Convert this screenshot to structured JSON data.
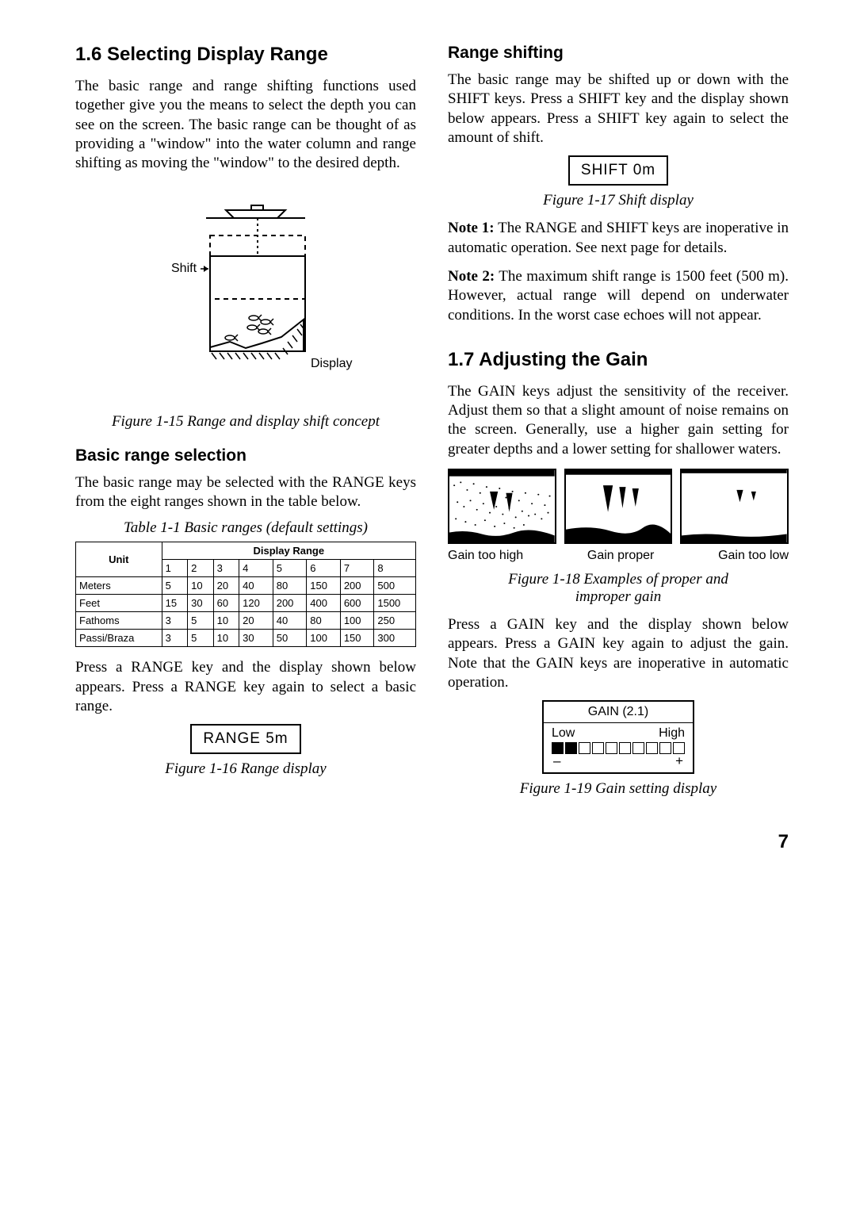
{
  "left": {
    "section_1_6_title": "1.6 Selecting Display Range",
    "para_1": "The basic range and range shifting functions used together give you the means to select the depth you can see on the screen. The basic range can be thought of as providing a \"window\" into the water column and range shifting as moving the \"window\" to the desired depth.",
    "shift_label": "Shift",
    "display_label": "Display",
    "fig15_caption": "Figure 1-15 Range and display shift concept",
    "basic_range_heading": "Basic range selection",
    "para_2": "The basic range may be selected with the RANGE keys from the eight ranges shown in the table below.",
    "table_caption": "Table 1-1 Basic ranges (default settings)",
    "table": {
      "unit_header": "Unit",
      "display_range_header": "Display Range",
      "col_nums": [
        "1",
        "2",
        "3",
        "4",
        "5",
        "6",
        "7",
        "8"
      ],
      "rows": [
        {
          "unit": "Meters",
          "vals": [
            "5",
            "10",
            "20",
            "40",
            "80",
            "150",
            "200",
            "500"
          ]
        },
        {
          "unit": "Feet",
          "vals": [
            "15",
            "30",
            "60",
            "120",
            "200",
            "400",
            "600",
            "1500"
          ]
        },
        {
          "unit": "Fathoms",
          "vals": [
            "3",
            "5",
            "10",
            "20",
            "40",
            "80",
            "100",
            "250"
          ]
        },
        {
          "unit": "Passi/Braza",
          "vals": [
            "3",
            "5",
            "10",
            "30",
            "50",
            "100",
            "150",
            "300"
          ]
        }
      ]
    },
    "para_3": "Press a RANGE key and the display shown below appears. Press a RANGE key again to select a basic range.",
    "range_box_text": "RANGE    5m",
    "fig16_caption": "Figure 1-16 Range display"
  },
  "right": {
    "range_shifting_heading": "Range shifting",
    "para_1": "The basic range may be shifted up or down with the SHIFT keys. Press a SHIFT key and the display shown below appears. Press a SHIFT key again to select the amount of shift.",
    "shift_box_text": "SHIFT    0m",
    "fig17_caption": "Figure 1-17 Shift display",
    "note1_bold": "Note 1:",
    "note1_text": " The RANGE and SHIFT keys are inoperative in automatic operation. See next page for details.",
    "note2_bold": "Note 2:",
    "note2_text": " The maximum shift range is 1500 feet (500 m). However, actual range will depend on underwater conditions. In the worst case echoes will not appear.",
    "section_1_7_title": "1.7 Adjusting the Gain",
    "para_2": "The GAIN keys adjust the sensitivity of the receiver. Adjust them so that a slight amount of noise remains on the screen. Generally, use a higher gain setting for greater depths and a lower setting for shallower waters.",
    "gain_label_high": "Gain too high",
    "gain_label_proper": "Gain proper",
    "gain_label_low": "Gain too low",
    "fig18_caption_l1": "Figure 1-18 Examples of proper and",
    "fig18_caption_l2": "improper gain",
    "para_3": "Press a GAIN key and the display shown below appears. Press a GAIN key again to adjust the gain. Note that the GAIN keys are inoperative in automatic operation.",
    "gain_meter_title": "GAIN (2.1)",
    "gain_low": "Low",
    "gain_high": "High",
    "gain_minus": "–",
    "gain_plus": "+",
    "fig19_caption": "Figure 1-19 Gain setting display"
  },
  "page_number": "7",
  "chart_data": {
    "type": "table",
    "title": "Table 1-1 Basic ranges (default settings)",
    "columns": [
      "Unit",
      "1",
      "2",
      "3",
      "4",
      "5",
      "6",
      "7",
      "8"
    ],
    "rows": [
      [
        "Meters",
        5,
        10,
        20,
        40,
        80,
        150,
        200,
        500
      ],
      [
        "Feet",
        15,
        30,
        60,
        120,
        200,
        400,
        600,
        1500
      ],
      [
        "Fathoms",
        3,
        5,
        10,
        20,
        40,
        80,
        100,
        250
      ],
      [
        "Passi/Braza",
        3,
        5,
        10,
        30,
        50,
        100,
        150,
        300
      ]
    ]
  }
}
